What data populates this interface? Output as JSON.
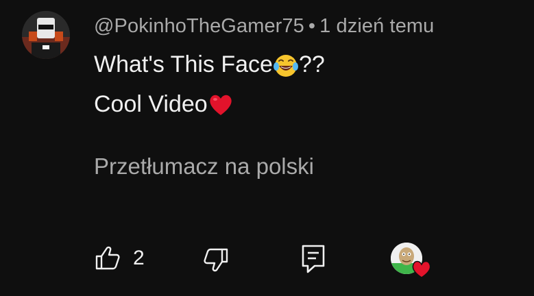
{
  "comment": {
    "author": "@PokinhoTheGamer75",
    "separator": "•",
    "time": "1 dzień temu",
    "lines": [
      "What's This Face",
      "??",
      "Cool Video"
    ],
    "translate_label": "Przetłumacz na polski",
    "like_count": "2"
  },
  "icons": {
    "avatar": "roblox-avatar",
    "emoji_laugh": "face-with-tears-of-joy-icon",
    "emoji_heart": "red-heart-icon",
    "like": "thumbs-up-icon",
    "dislike": "thumbs-down-icon",
    "reply": "reply-icon",
    "creator_heart": "creator-heart-icon"
  },
  "colors": {
    "background": "#0f0f0f",
    "primary_text": "#f1f1f1",
    "secondary_text": "#aaaaaa",
    "heart": "#e2132b"
  }
}
